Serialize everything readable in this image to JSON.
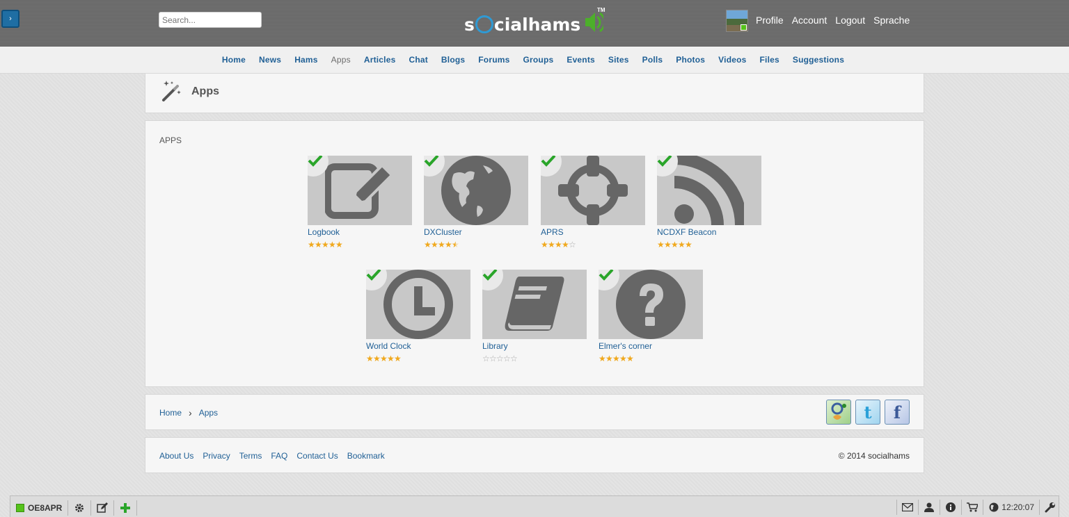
{
  "header": {
    "search_placeholder": "Search...",
    "logo_text_pre": "s",
    "logo_text_post": "cialhams",
    "logo_tm": "TM",
    "user_nav": [
      "Profile",
      "Account",
      "Logout",
      "Sprache"
    ]
  },
  "nav": {
    "items": [
      "Home",
      "News",
      "Hams",
      "Apps",
      "Articles",
      "Chat",
      "Blogs",
      "Forums",
      "Groups",
      "Events",
      "Sites",
      "Polls",
      "Photos",
      "Videos",
      "Files",
      "Suggestions"
    ],
    "active": "Apps"
  },
  "page": {
    "title": "Apps",
    "section_label": "APPS"
  },
  "apps": [
    {
      "name": "Logbook",
      "icon": "pencil-edit-icon",
      "rating": 5,
      "installed": true
    },
    {
      "name": "DXCluster",
      "icon": "globe-icon",
      "rating": 4.5,
      "installed": true
    },
    {
      "name": "APRS",
      "icon": "crosshair-icon",
      "rating": 4,
      "installed": true
    },
    {
      "name": "NCDXF Beacon",
      "icon": "rss-icon",
      "rating": 5,
      "installed": true
    },
    {
      "name": "World Clock",
      "icon": "clock-icon",
      "rating": 5,
      "installed": true
    },
    {
      "name": "Library",
      "icon": "book-icon",
      "rating": 0,
      "installed": true
    },
    {
      "name": "Elmer's corner",
      "icon": "question-icon",
      "rating": 5,
      "installed": true
    }
  ],
  "breadcrumb": {
    "home": "Home",
    "separator": "›",
    "current": "Apps"
  },
  "social": [
    "google-plus-icon",
    "twitter-icon",
    "facebook-icon"
  ],
  "footer": {
    "links": [
      "About Us",
      "Privacy",
      "Terms",
      "FAQ",
      "Contact Us",
      "Bookmark"
    ],
    "copyright": "© 2014 socialhams"
  },
  "bottombar": {
    "callsign": "OE8APR",
    "clock": "12:20:07"
  },
  "colors": {
    "link": "#1f5f95",
    "star": "#f0a81c",
    "check": "#2aa52a",
    "status_online": "#55c21a"
  }
}
